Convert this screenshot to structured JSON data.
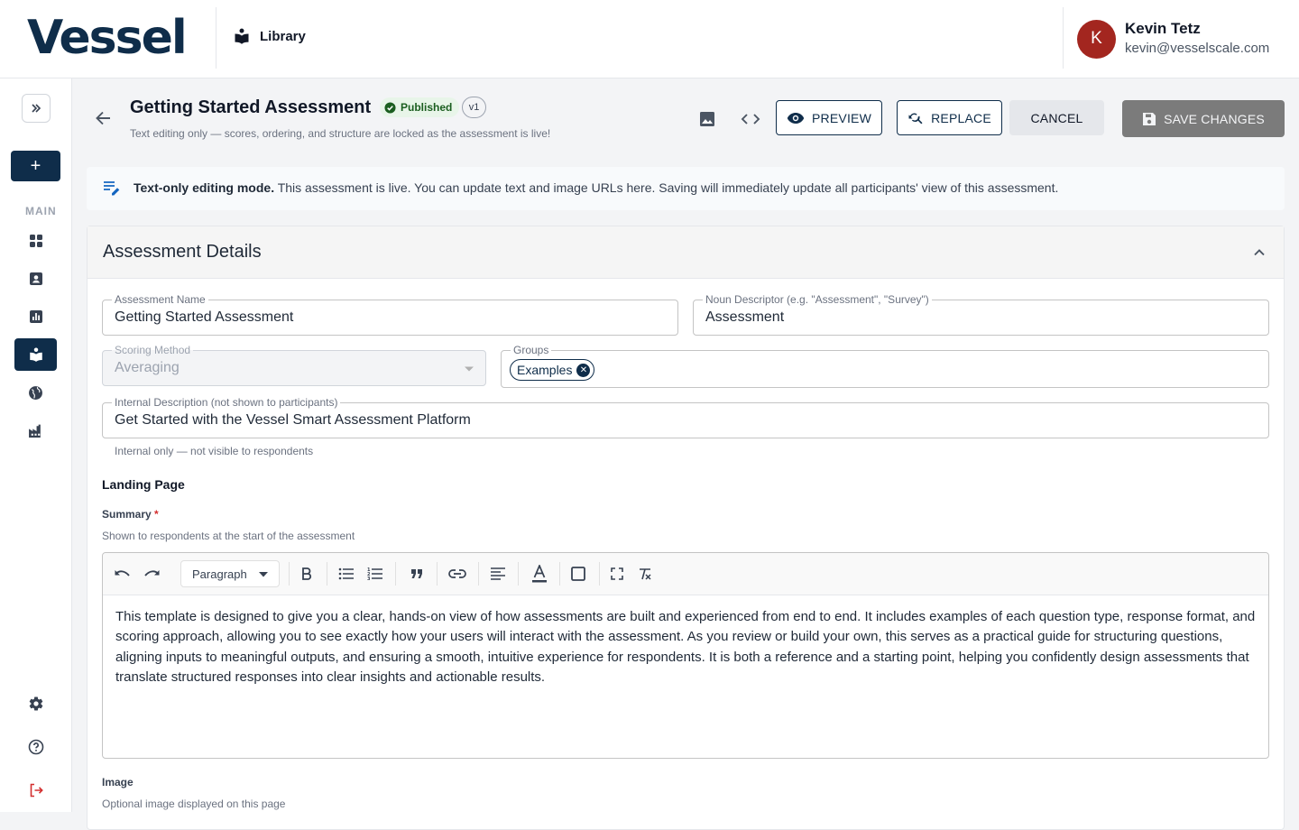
{
  "brand": {
    "logo": "Vessel"
  },
  "top_nav": {
    "library_label": "Library"
  },
  "user": {
    "initial": "K",
    "name": "Kevin Tetz",
    "email": "kevin@vesselscale.com"
  },
  "sidebar": {
    "section_label": "MAIN",
    "add_label": "+"
  },
  "header": {
    "title": "Getting Started Assessment",
    "status_badge": "Published",
    "version_badge": "v1",
    "subtitle": "Text editing only — scores, ordering, and structure are locked as the assessment is live!",
    "preview_label": "PREVIEW",
    "replace_label": "REPLACE",
    "cancel_label": "CANCEL",
    "save_label": "SAVE CHANGES"
  },
  "banner": {
    "strong": "Text-only editing mode.",
    "text": " This assessment is live. You can update text and image URLs here. Saving will immediately update all participants' view of this assessment."
  },
  "details": {
    "title": "Assessment Details",
    "assessment_name": {
      "label": "Assessment Name",
      "value": "Getting Started Assessment"
    },
    "noun_descriptor": {
      "label": "Noun Descriptor (e.g. \"Assessment\", \"Survey\")",
      "value": "Assessment"
    },
    "scoring_method": {
      "label": "Scoring Method",
      "value": "Averaging"
    },
    "groups": {
      "label": "Groups",
      "chips": [
        "Examples"
      ]
    },
    "internal_description": {
      "label": "Internal Description (not shown to participants)",
      "value": "Get Started with the Vessel Smart Assessment Platform",
      "helper": "Internal only — not visible to respondents"
    }
  },
  "landing": {
    "title": "Landing Page",
    "summary_label": "Summary",
    "required_mark": "*",
    "summary_helper": "Shown to respondents at the start of the assessment",
    "paragraph_select": "Paragraph",
    "summary_text": "This template is designed to give you a clear, hands-on view of how assessments are built and experienced from end to end. It includes examples of each question type, response format, and scoring approach, allowing you to see exactly how your users will interact with the assessment. As you review or build your own, this serves as a practical guide for structuring questions, aligning inputs to meaningful outputs, and ensuring a smooth, intuitive experience for respondents. It is both a reference and a starting point, helping you confidently design assessments that translate structured responses into clear insights and actionable results.",
    "image_label": "Image",
    "image_helper": "Optional image displayed on this page"
  },
  "colors": {
    "brand_navy": "#0f2d4a",
    "avatar_red": "#a3261f",
    "published_green": "#1b5e20",
    "logout_red": "#d32f2f"
  }
}
